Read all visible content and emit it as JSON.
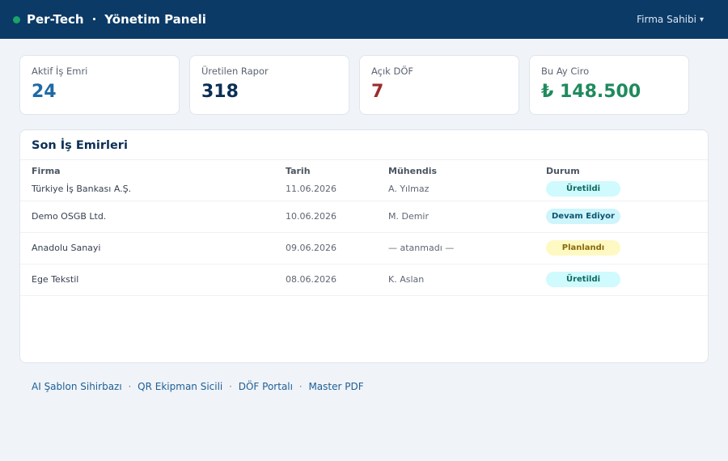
{
  "header": {
    "brand": "Per-Tech",
    "separator": "·",
    "title": "Yönetim Paneli",
    "user_menu": "Firma Sahibi",
    "user_caret": "▾"
  },
  "stats": [
    {
      "label": "Aktif İş Emri",
      "value": "24",
      "color": "#1f6aa6"
    },
    {
      "label": "Üretilen Rapor",
      "value": "318",
      "color": "#0b2f55"
    },
    {
      "label": "Açık DÖF",
      "value": "7",
      "color": "#9b2d2d"
    },
    {
      "label": "Bu Ay Ciro",
      "value": "₺ 148.500",
      "color": "#1f8a5e"
    }
  ],
  "work_orders": {
    "title": "Son İş Emirleri",
    "columns": [
      "Firma",
      "Tarih",
      "Mühendis",
      "Durum"
    ],
    "rows": [
      {
        "firma": "Türkiye İş Bankası A.Ş.",
        "tarih": "11.06.2026",
        "muhendis": "A. Yılmaz",
        "durum": "Üretildi"
      },
      {
        "firma": "Demo OSGB Ltd.",
        "tarih": "10.06.2026",
        "muhendis": "M. Demir",
        "durum": "Devam Ediyor"
      },
      {
        "firma": "Anadolu Sanayi",
        "tarih": "09.06.2026",
        "muhendis": "— atanmadı —",
        "durum": "Planlandı"
      },
      {
        "firma": "Ege Tekstil",
        "tarih": "08.06.2026",
        "muhendis": "K. Aslan",
        "durum": "Üretildi"
      }
    ],
    "status_colors": {
      "Üretildi": {
        "bg": "#cffafe",
        "fg": "#0e6b61"
      },
      "Devam Ediyor": {
        "bg": "#cdf5fb",
        "fg": "#0b5570"
      },
      "Planlandı": {
        "bg": "#fef9c3",
        "fg": "#8a6a0a"
      }
    }
  },
  "footer_links": {
    "separator": "·",
    "items": [
      "AI Şablon Sihirbazı",
      "QR Ekipman Sicili",
      "DÖF Portalı",
      "Master PDF"
    ]
  }
}
